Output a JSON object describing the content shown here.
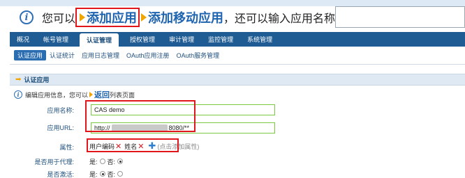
{
  "banner": {
    "prefix": "您可以",
    "add_app": "添加应用",
    "add_mobile_app": "添加移动应用",
    "suffix": "，还可以输入应用名称:"
  },
  "mainnav": {
    "tabs": [
      {
        "label": "概况"
      },
      {
        "label": "帐号管理"
      },
      {
        "label": "认证管理",
        "active": true
      },
      {
        "label": "授权管理"
      },
      {
        "label": "审计管理"
      },
      {
        "label": "监控管理"
      },
      {
        "label": "系统管理"
      }
    ]
  },
  "subnav": {
    "tabs": [
      {
        "label": "认证应用",
        "active": true
      },
      {
        "label": "认证统计"
      },
      {
        "label": "应用日志管理"
      },
      {
        "label": "OAuth应用注册"
      },
      {
        "label": "OAuth服务管理"
      }
    ]
  },
  "section": {
    "title": "认证应用"
  },
  "info": {
    "prefix": "编辑应用信息，您可以",
    "back": "返回",
    "suffix": "列表页面"
  },
  "form": {
    "app_name_label": "应用名称:",
    "app_name_value": "CAS demo",
    "app_url_label": "应用URL:",
    "app_url_prefix": "http://",
    "app_url_suffix": "8080/**",
    "attr_label": "属性:",
    "attr1": "用户编码",
    "attr2": "姓名",
    "attr_hint": "(点击添加属性)",
    "proxy_label": "是否用于代理:",
    "active_label": "是否激活:",
    "yes": "是:",
    "no": "否:",
    "proxy_selected": "no",
    "active_selected": "yes"
  },
  "colors": {
    "nav": "#1e5c93",
    "highlight": "#e0161b",
    "link": "#1f64b0",
    "field_border": "#7ac943"
  }
}
